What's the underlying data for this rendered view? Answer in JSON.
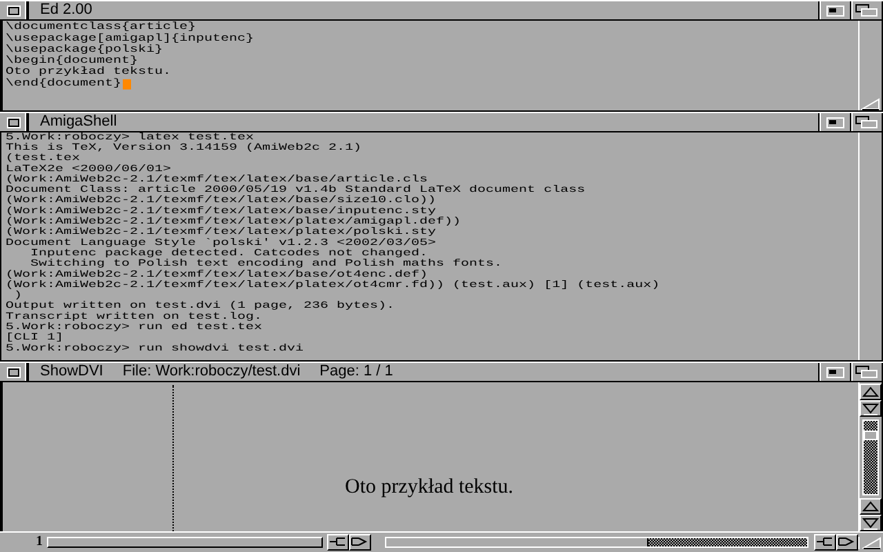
{
  "windows": [
    {
      "kind": "editor",
      "title": "Ed 2.00",
      "cursor": true,
      "lines": [
        "\\documentclass{article}",
        "\\usepackage[amigapl]{inputenc}",
        "\\usepackage{polski}",
        "\\begin{document}",
        "Oto przykład tekstu.",
        "\\end{document}"
      ]
    },
    {
      "kind": "shell",
      "title": "AmigaShell",
      "lines": [
        "5.Work:roboczy> latex test.tex",
        "This is TeX, Version 3.14159 (AmiWeb2c 2.1)",
        "(test.tex",
        "LaTeX2e <2000/06/01>",
        "(Work:AmiWeb2c-2.1/texmf/tex/latex/base/article.cls",
        "Document Class: article 2000/05/19 v1.4b Standard LaTeX document class",
        "(Work:AmiWeb2c-2.1/texmf/tex/latex/base/size10.clo))",
        "(Work:AmiWeb2c-2.1/texmf/tex/latex/base/inputenc.sty",
        "(Work:AmiWeb2c-2.1/texmf/tex/latex/platex/amigapl.def))",
        "(Work:AmiWeb2c-2.1/texmf/tex/latex/platex/polski.sty",
        "Document Language Style `polski' v1.2.3 <2002/03/05>",
        "   Inputenc package detected. Catcodes not changed.",
        "   Switching to Polish text encoding and Polish maths fonts.",
        "(Work:AmiWeb2c-2.1/texmf/tex/latex/base/ot4enc.def)",
        "(Work:AmiWeb2c-2.1/texmf/tex/latex/platex/ot4cmr.fd)) (test.aux) [1] (test.aux)",
        " )",
        "Output written on test.dvi (1 page, 236 bytes).",
        "Transcript written on test.log.",
        "5.Work:roboczy> run ed test.tex",
        "[CLI 1]",
        "5.Work:roboczy> run showdvi test.dvi"
      ]
    },
    {
      "kind": "viewer",
      "title": "ShowDVI",
      "file": "File: Work:roboczy/test.dvi",
      "page": "Page: 1 / 1",
      "page_text": "Oto przykład tekstu.",
      "page_number": "1"
    }
  ]
}
